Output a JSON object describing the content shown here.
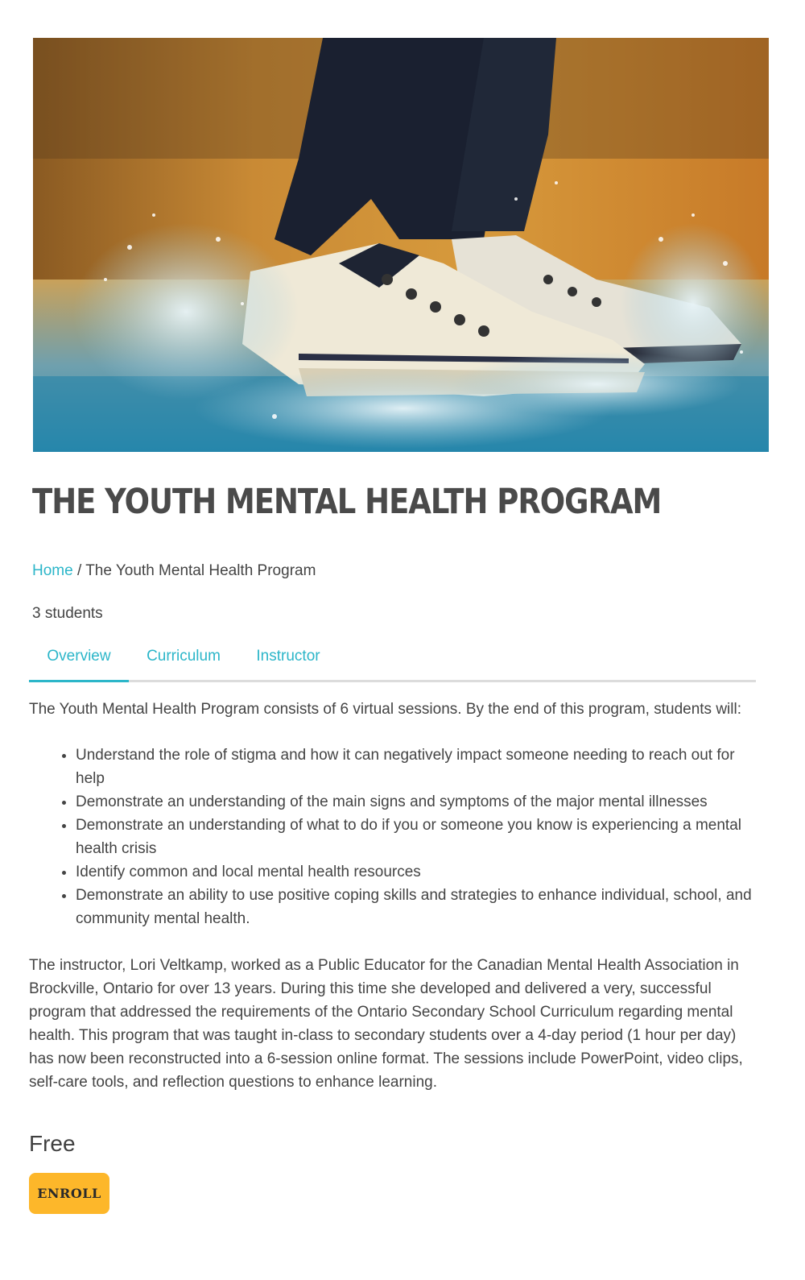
{
  "hero": {
    "image": "sneakers splashing in water puddle"
  },
  "course": {
    "title": "THE YOUTH MENTAL HEALTH PROGRAM",
    "students": "3 students"
  },
  "breadcrumb": {
    "home": "Home",
    "separator": " / ",
    "current": "The Youth Mental Health Program"
  },
  "tabs": [
    {
      "label": "Overview",
      "active": true
    },
    {
      "label": "Curriculum",
      "active": false
    },
    {
      "label": "Instructor",
      "active": false
    }
  ],
  "overview": {
    "intro": "The Youth Mental Health Program consists of 6 virtual sessions. By the end of this program, students will:",
    "outcomes": [
      "Understand the role of stigma and how it can negatively impact someone needing to reach out for help",
      "Demonstrate an understanding of the main signs and symptoms of the major mental illnesses",
      "Demonstrate an understanding of what to do if you or someone you know is experiencing a mental health crisis",
      "Identify common and local mental health resources",
      "Demonstrate an ability to use positive coping skills and strategies to enhance individual, school, and community mental health."
    ],
    "bio": "The instructor, Lori Veltkamp, worked as a Public Educator for the Canadian Mental Health Association in Brockville, Ontario for over 13 years. During this time she developed and delivered a very, successful program that addressed the requirements of the Ontario Secondary School Curriculum regarding mental health. This program that was taught in-class to secondary students over a 4-day period (1 hour per day) has now been reconstructed into a 6-session online format. The sessions include PowerPoint, video clips, self-care tools, and reflection questions to enhance learning."
  },
  "pricing": {
    "price": "Free",
    "enroll_label": "ENROLL"
  },
  "colors": {
    "accent": "#2cb6c9",
    "button": "#fdb72a"
  }
}
